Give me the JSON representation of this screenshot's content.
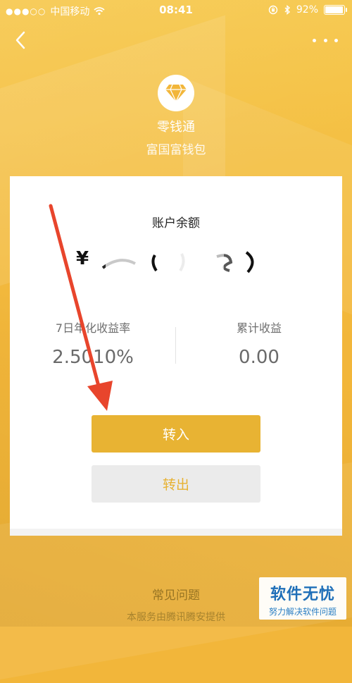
{
  "status_bar": {
    "carrier": "中国移动",
    "time": "08:41",
    "battery": "92%"
  },
  "product": {
    "name": "零钱通",
    "subtitle": "富国富钱包"
  },
  "account": {
    "balance_label": "账户余额",
    "currency_symbol": "¥",
    "stats": {
      "annual_yield_label": "7日年化收益率",
      "annual_yield_value": "2.5010%",
      "total_income_label": "累计收益",
      "total_income_value": "0.00"
    }
  },
  "actions": {
    "transfer_in": "转入",
    "transfer_out": "转出"
  },
  "footer": {
    "faq": "常见问题",
    "provider": "本服务由腾讯腾安提供"
  },
  "watermark": {
    "title": "软件无忧",
    "subtitle": "努力解决软件问题"
  },
  "colors": {
    "background": "#f2b63a",
    "primary_button": "#e8b333",
    "annotation_arrow": "#e8452c"
  }
}
